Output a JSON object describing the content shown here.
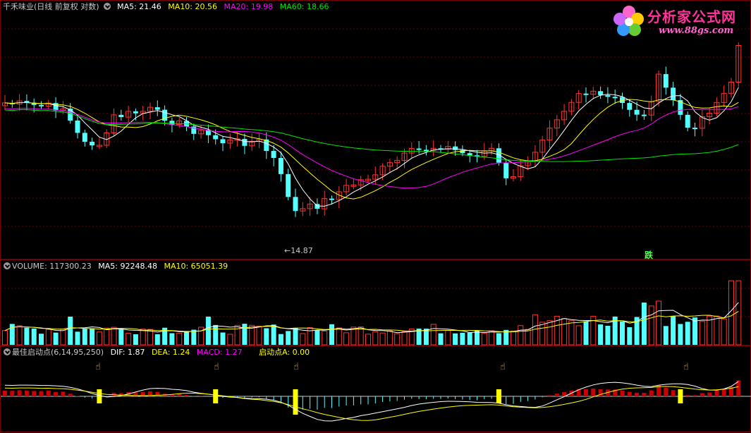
{
  "price_panel": {
    "title": "千禾味业(日线 前复权 对数)",
    "ma5": "MA5: 21.46",
    "ma10": "MA10: 20.56",
    "ma20": "MA20: 19.98",
    "ma60": "MA60: 18.66",
    "low_marker": "14.87",
    "signal_label": "跌"
  },
  "volume_panel": {
    "volume": "VOLUME: 117300.23",
    "ma5": "MA5: 92248.48",
    "ma10": "MA10: 65051.39"
  },
  "indicator_panel": {
    "name": "最佳启动点(6,14,95,250)",
    "dif": "DIF: 1.87",
    "dea": "DEA: 1.24",
    "macd": "MACD: 1.27",
    "signal": "启动点A: 0.00"
  },
  "logo": {
    "text": "分析家公式网",
    "url": "www.88gs.com"
  },
  "colors": {
    "background": "#000000",
    "border": "#7a0000",
    "up": "#ff3232",
    "down": "#54ffff",
    "ma5": "#ffffff",
    "ma10": "#ffff00",
    "ma20": "#ff00ff",
    "ma60": "#00e600",
    "signal_bar": "#ffff00"
  }
}
